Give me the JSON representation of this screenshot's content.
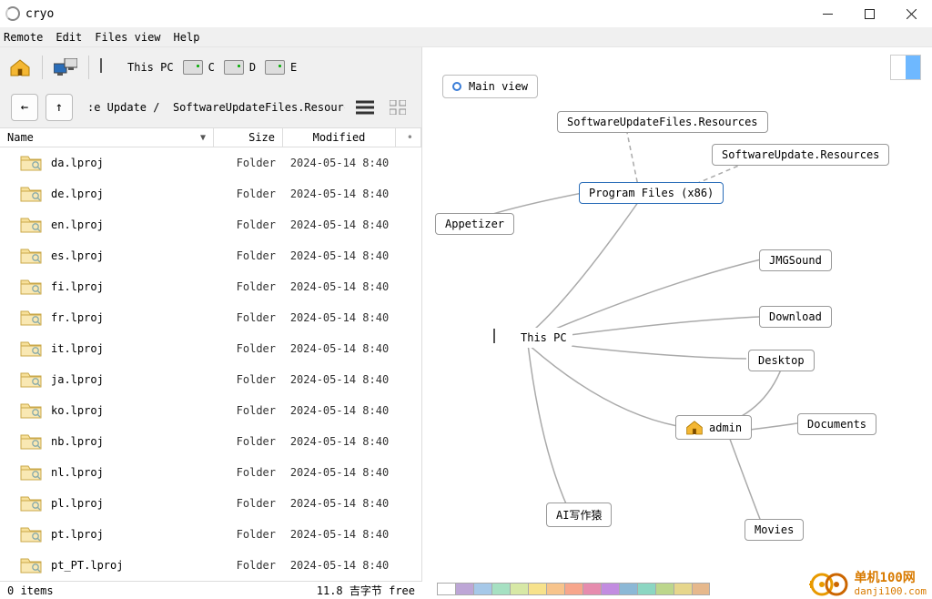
{
  "app": {
    "title": "cryo"
  },
  "menu": {
    "remote": "Remote",
    "edit": "Edit",
    "filesview": "Files view",
    "help": "Help"
  },
  "toolbar": {
    "thispc": "This PC",
    "drives": [
      "C",
      "D",
      "E"
    ]
  },
  "breadcrumb": {
    "part1": ":e Update /",
    "part2": "SoftwareUpdateFiles.Resources"
  },
  "columns": {
    "name": "Name",
    "size": "Size",
    "modified": "Modified"
  },
  "files": [
    {
      "name": "da.lproj",
      "size": "Folder",
      "modified": "2024-05-14  8:40"
    },
    {
      "name": "de.lproj",
      "size": "Folder",
      "modified": "2024-05-14  8:40"
    },
    {
      "name": "en.lproj",
      "size": "Folder",
      "modified": "2024-05-14  8:40"
    },
    {
      "name": "es.lproj",
      "size": "Folder",
      "modified": "2024-05-14  8:40"
    },
    {
      "name": "fi.lproj",
      "size": "Folder",
      "modified": "2024-05-14  8:40"
    },
    {
      "name": "fr.lproj",
      "size": "Folder",
      "modified": "2024-05-14  8:40"
    },
    {
      "name": "it.lproj",
      "size": "Folder",
      "modified": "2024-05-14  8:40"
    },
    {
      "name": "ja.lproj",
      "size": "Folder",
      "modified": "2024-05-14  8:40"
    },
    {
      "name": "ko.lproj",
      "size": "Folder",
      "modified": "2024-05-14  8:40"
    },
    {
      "name": "nb.lproj",
      "size": "Folder",
      "modified": "2024-05-14  8:40"
    },
    {
      "name": "nl.lproj",
      "size": "Folder",
      "modified": "2024-05-14  8:40"
    },
    {
      "name": "pl.lproj",
      "size": "Folder",
      "modified": "2024-05-14  8:40"
    },
    {
      "name": "pt.lproj",
      "size": "Folder",
      "modified": "2024-05-14  8:40"
    },
    {
      "name": "pt_PT.lproj",
      "size": "Folder",
      "modified": "2024-05-14  8:40"
    }
  ],
  "mainview": {
    "label": "Main view"
  },
  "graph": {
    "nodes": {
      "suf": "SoftwareUpdateFiles.Resources",
      "sur": "SoftwareUpdate.Resources",
      "pfx86": "Program Files (x86)",
      "appetizer": "Appetizer",
      "thispc": "This PC",
      "jmgsound": "JMGSound",
      "download": "Download",
      "desktop": "Desktop",
      "documents": "Documents",
      "admin": "admin",
      "ai": "AI写作猿",
      "movies": "Movies"
    }
  },
  "status": {
    "items": "0 items",
    "free": "11.8 吉字节 free"
  },
  "palette": [
    "#ffffff",
    "#bda6d6",
    "#a6c8e8",
    "#a6e0c2",
    "#d7e8a6",
    "#f7e28c",
    "#f7c48c",
    "#f7a68c",
    "#e68cae",
    "#c28ce0",
    "#8cb8d6",
    "#8cd6c2",
    "#bcd68c",
    "#e6d68c",
    "#e6b88c"
  ],
  "watermark": {
    "name": "单机100网",
    "url": "danji100.com"
  }
}
